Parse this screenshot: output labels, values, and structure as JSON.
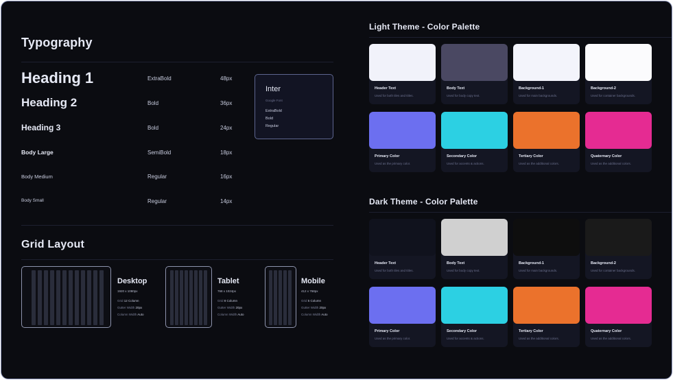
{
  "typography": {
    "title": "Typography",
    "rows": [
      {
        "name": "Heading 1",
        "weight": "ExtraBold",
        "size": "48px"
      },
      {
        "name": "Heading 2",
        "weight": "Bold",
        "size": "36px"
      },
      {
        "name": "Heading 3",
        "weight": "Bold",
        "size": "24px"
      },
      {
        "name": "Body Large",
        "weight": "SemiBold",
        "size": "18px"
      },
      {
        "name": "Body Medium",
        "weight": "Regular",
        "size": "16px"
      },
      {
        "name": "Body Small",
        "weight": "Regular",
        "size": "14px"
      }
    ],
    "font_card": {
      "name": "Inter",
      "source": "Google Font",
      "weights": [
        "ExtraBold",
        "Bold",
        "Regular"
      ]
    }
  },
  "grid_layout": {
    "title": "Grid Layout",
    "devices": [
      {
        "name": "Desktop",
        "size": "1920 x 1080px",
        "grid_label": "Grid",
        "grid_value": "12 Column",
        "gutter_label": "Gutter Width",
        "gutter_value": "20px",
        "column_label": "Column Width",
        "column_value": "Auto",
        "columns": 12
      },
      {
        "name": "Tablet",
        "size": "768 x 1024px",
        "grid_label": "Grid",
        "grid_value": "8 Column",
        "gutter_label": "Gutter Width",
        "gutter_value": "20px",
        "column_label": "Column Width",
        "column_value": "Auto",
        "columns": 8
      },
      {
        "name": "Mobile",
        "size": "412 x 768px",
        "grid_label": "Grid",
        "grid_value": "5 Column",
        "gutter_label": "Gutter Width",
        "gutter_value": "20px",
        "column_label": "Column Width",
        "column_value": "Auto",
        "columns": 5
      }
    ]
  },
  "light_palette": {
    "title": "Light Theme - Color Palette",
    "colors": [
      {
        "name": "Header Text",
        "desc": "Used for both tiles and titles.",
        "color": "#f1f2fa"
      },
      {
        "name": "Body Text",
        "desc": "Used for body copy text.",
        "color": "#4a4862"
      },
      {
        "name": "Background-1",
        "desc": "Used for main backgrounds.",
        "color": "#f3f4fb"
      },
      {
        "name": "Background-2",
        "desc": "Used for container backgrounds.",
        "color": "#fbfbfd"
      },
      {
        "name": "Primary Color",
        "desc": "Used as the primary color.",
        "color": "#6c6ff0"
      },
      {
        "name": "Secondary Color",
        "desc": "Used for accents & actions.",
        "color": "#2cd0e3"
      },
      {
        "name": "Tertiary Color",
        "desc": "Used as the additional colors.",
        "color": "#eb722c"
      },
      {
        "name": "Quaternary Color",
        "desc": "Used as the additional colors.",
        "color": "#e52b92"
      }
    ]
  },
  "dark_palette": {
    "title": "Dark Theme - Color Palette",
    "colors": [
      {
        "name": "Header Text",
        "desc": "Used for both tiles and titles.",
        "color": "#10121d"
      },
      {
        "name": "Body Text",
        "desc": "Used for body copy text.",
        "color": "#d0d0d0"
      },
      {
        "name": "Background-1",
        "desc": "Used for main backgrounds.",
        "color": "#0e0e0e"
      },
      {
        "name": "Background-2",
        "desc": "Used for container backgrounds.",
        "color": "#1a1a1a"
      },
      {
        "name": "Primary Color",
        "desc": "Used as the primary color.",
        "color": "#6c6ff0"
      },
      {
        "name": "Secondary Color",
        "desc": "Used for accents & actions.",
        "color": "#2cd0e3"
      },
      {
        "name": "Tertiary Color",
        "desc": "Used as the additional colors.",
        "color": "#eb722c"
      },
      {
        "name": "Quaternary Color",
        "desc": "Used as the additional colors.",
        "color": "#e52b92"
      }
    ]
  }
}
